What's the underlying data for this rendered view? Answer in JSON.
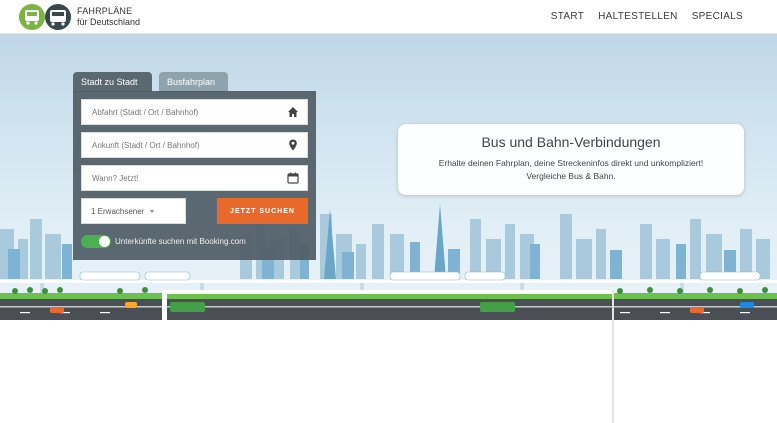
{
  "header": {
    "logo_line1": "FAHRPLÄNE",
    "logo_line2": "für Deutschland",
    "nav": [
      "START",
      "HALTESTELLEN",
      "SPECIALS"
    ]
  },
  "search": {
    "tabs": [
      "Stadt zu Stadt",
      "Busfahrplan"
    ],
    "active_tab": "Stadt zu Stadt",
    "departure_placeholder": "Abfahrt (Stadt / Ort / Bahnhof)",
    "arrival_placeholder": "Ankunft (Stadt / Ort / Bahnhof)",
    "date_placeholder": "Wann? Jetzt!",
    "passengers": "1 Erwachsener",
    "submit": "JETZT SUCHEN",
    "booking_toggle_label": "Unterkünfte suchen mit Booking.com",
    "booking_toggle_on": true,
    "icons": [
      "home-icon",
      "location-pin-icon",
      "calendar-icon"
    ]
  },
  "info": {
    "title": "Bus und Bahn-Verbindungen",
    "line1": "Erhalte deinen Fahrplan, deine Streckeninfos direkt und unkompliziert!",
    "line2": "Vergleiche Bus & Bahn."
  },
  "colors": {
    "accent": "#e8692a",
    "toggle": "#4caf50",
    "panel": "#505e66",
    "sky": "#cfe3ef"
  }
}
